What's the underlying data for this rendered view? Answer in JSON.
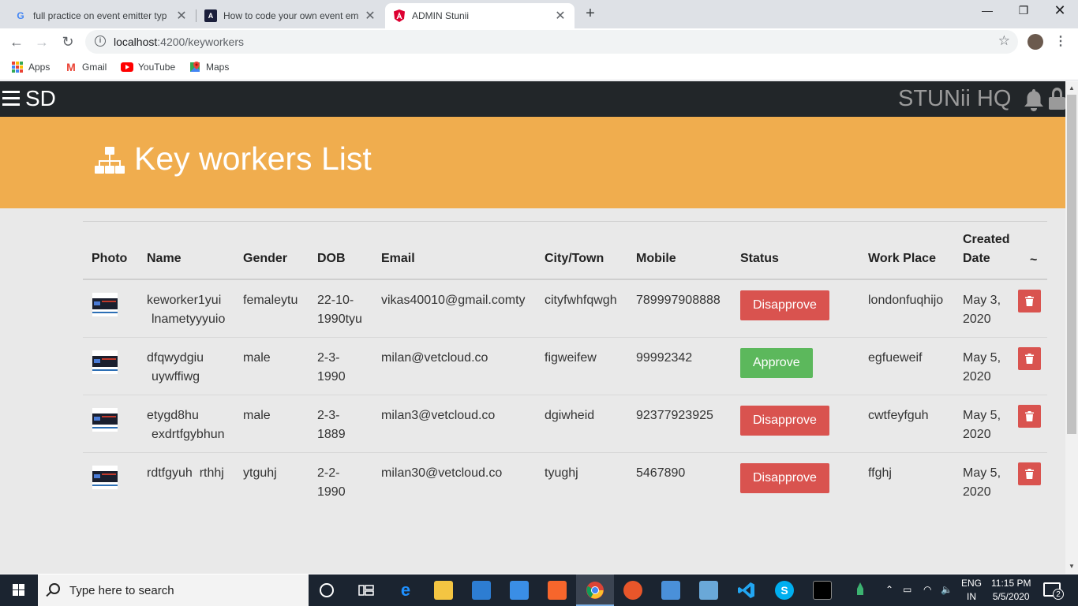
{
  "browser": {
    "tabs": [
      {
        "title": "full practice on event emitter typ",
        "favicon": "google-g-icon",
        "active": false
      },
      {
        "title": "How to code your own event em",
        "favicon": "blog-logo-icon",
        "active": false
      },
      {
        "title": "ADMIN Stunii",
        "favicon": "angular-icon",
        "active": true
      }
    ],
    "new_tab_label": "+",
    "url_host": "localhost",
    "url_rest": ":4200/keyworkers",
    "bookmarks": [
      {
        "label": "Apps",
        "icon": "apps-grid-icon"
      },
      {
        "label": "Gmail",
        "icon": "gmail-icon"
      },
      {
        "label": "YouTube",
        "icon": "youtube-icon"
      },
      {
        "label": "Maps",
        "icon": "maps-icon"
      }
    ]
  },
  "app": {
    "brand": "SD",
    "hq_title": "STUNii HQ",
    "page_title": "Key workers List",
    "colors": {
      "navbar": "#222629",
      "banner": "#f0ad4e",
      "danger": "#d9534f",
      "success": "#5cb85c"
    },
    "table": {
      "headers": {
        "photo": "Photo",
        "name": "Name",
        "gender": "Gender",
        "dob": "DOB",
        "email": "Email",
        "city": "City/Town",
        "mobile": "Mobile",
        "status": "Status",
        "workplace": "Work Place",
        "created_1": "Created",
        "created_2": "Date",
        "actions": "~"
      },
      "rows": [
        {
          "name_1": "keworker1yui",
          "name_2": "lnametyyyuio",
          "gender": "femaleytu",
          "dob_1": "22-10-",
          "dob_2": "1990tyu",
          "email": "vikas40010@gmail.comty",
          "city": "cityfwhfqwgh",
          "mobile": "789997908888",
          "status": "Disapprove",
          "workplace": "londonfuqhijo",
          "created_1": "May 3,",
          "created_2": "2020"
        },
        {
          "name_1": "dfqwydgiu",
          "name_2": "uywffiwg",
          "gender": "male",
          "dob_1": "2-3-",
          "dob_2": "1990",
          "email": "milan@vetcloud.co",
          "city": "figweifew",
          "mobile": "99992342",
          "status": "Approve",
          "workplace": "egfueweif",
          "created_1": "May 5,",
          "created_2": "2020"
        },
        {
          "name_1": "etygd8hu",
          "name_2": "exdrtfgybhun",
          "gender": "male",
          "dob_1": "2-3-",
          "dob_2": "1889",
          "email": "milan3@vetcloud.co",
          "city": "dgiwheid",
          "mobile": "92377923925",
          "status": "Disapprove",
          "workplace": "cwtfeyfguh",
          "created_1": "May 5,",
          "created_2": "2020"
        },
        {
          "name_1": "rdtfgyuh  rthhj",
          "name_2": "",
          "gender": "ytguhj",
          "dob_1": "2-2-",
          "dob_2": "1990",
          "email": "milan30@vetcloud.co",
          "city": "tyughj",
          "mobile": "5467890",
          "status": "Disapprove",
          "workplace": "ffghj",
          "created_1": "May 5,",
          "created_2": "2020"
        }
      ]
    }
  },
  "taskbar": {
    "search_placeholder": "Type here to search",
    "lang_1": "ENG",
    "lang_2": "IN",
    "time": "11:15 PM",
    "date": "5/5/2020",
    "notification_count": "2"
  }
}
